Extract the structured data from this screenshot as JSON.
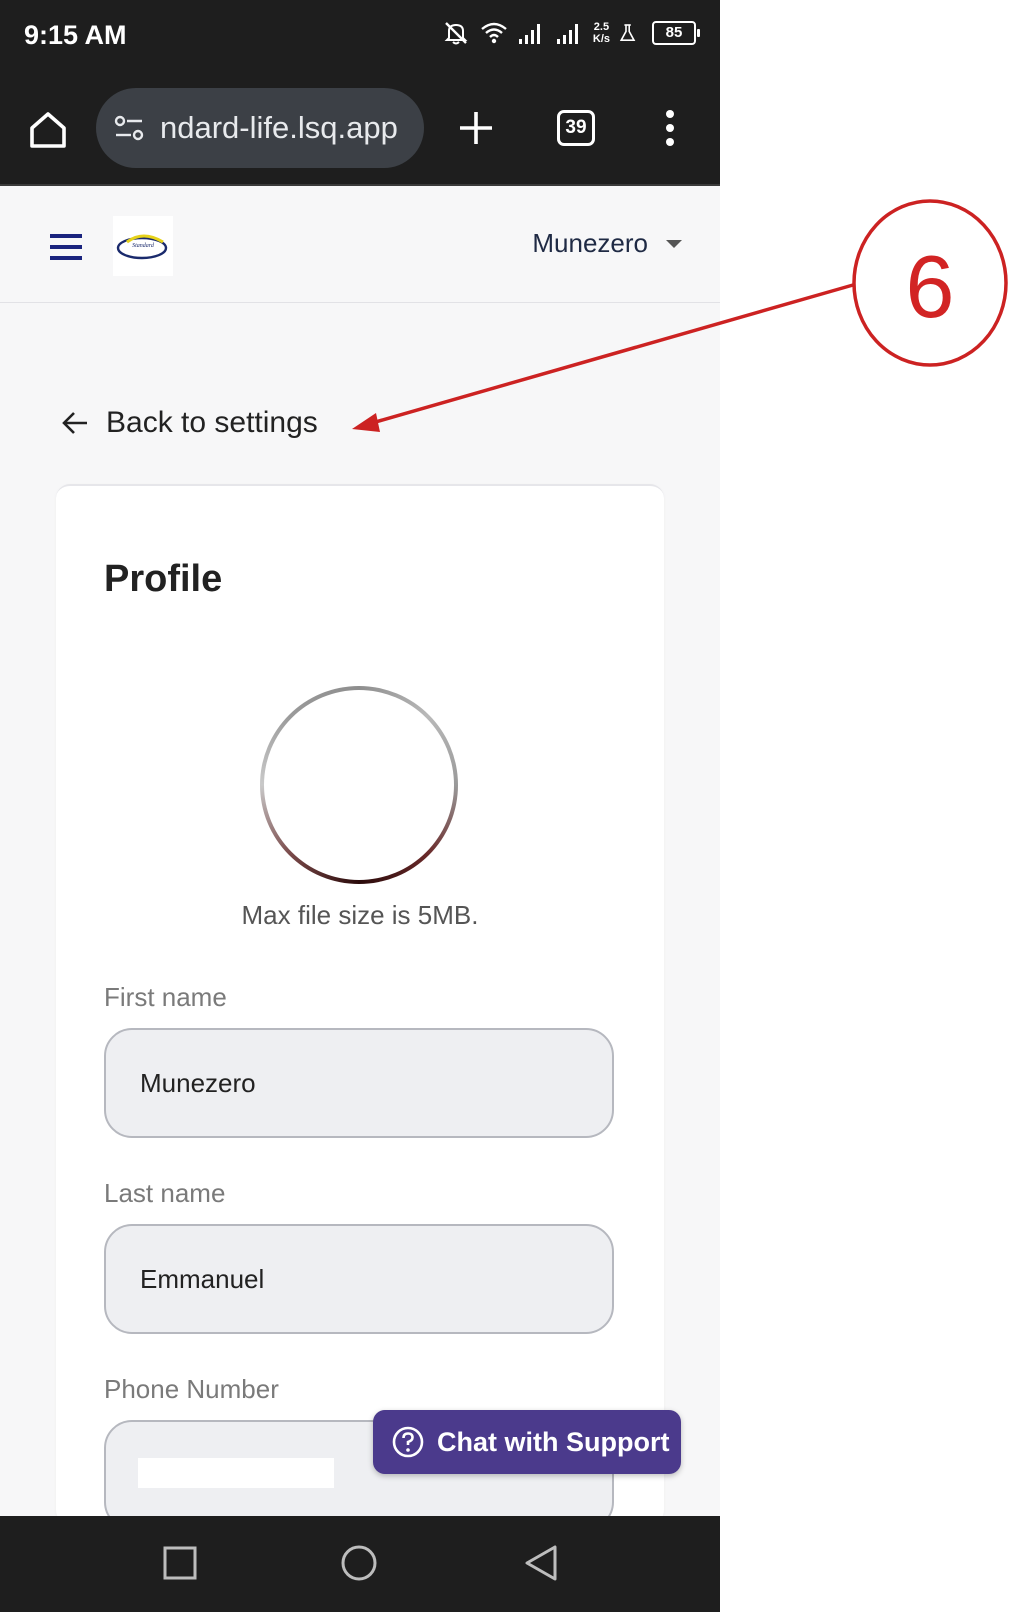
{
  "status_bar": {
    "time": "9:15 AM",
    "net_speed_value": "2.5",
    "net_speed_unit": "K/s",
    "battery": "85"
  },
  "browser": {
    "url": "ndard-life.lsq.app",
    "tab_count": "39"
  },
  "header": {
    "user_name": "Munezero"
  },
  "back_link": {
    "label": "Back to settings"
  },
  "profile": {
    "title": "Profile",
    "max_size_note": "Max file size is 5MB.",
    "fields": [
      {
        "label": "First name",
        "value": "Munezero"
      },
      {
        "label": "Last name",
        "value": "Emmanuel"
      },
      {
        "label": "Phone Number",
        "value": ""
      }
    ]
  },
  "chat_support": {
    "label": "Chat with Support"
  },
  "annotation": {
    "number": "6",
    "color": "#d22424"
  },
  "colors": {
    "chat_button": "#4b3a8c",
    "brand_text": "#1f2a44"
  }
}
